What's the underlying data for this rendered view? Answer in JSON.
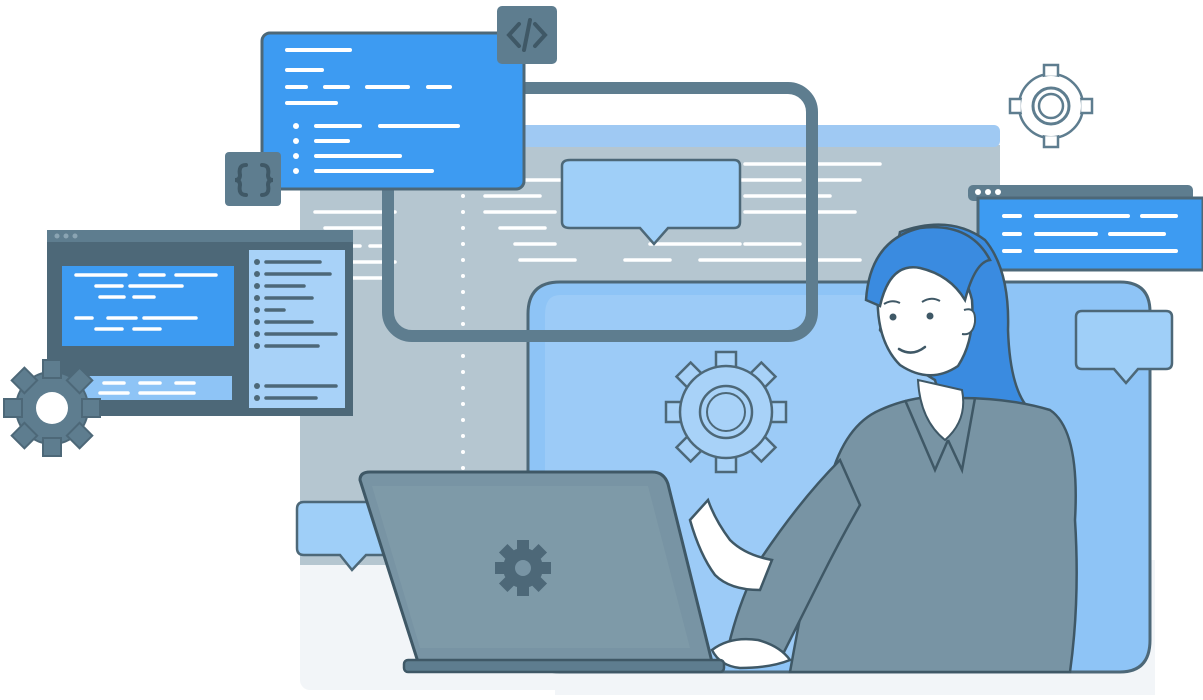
{
  "colors": {
    "background": "#ffffff",
    "panel_light": "#f2f5f8",
    "slate": "#5e7d8f",
    "slate_dark": "#4d6878",
    "slate_mid": "#7894a4",
    "slate_light": "#aebfc9",
    "blue_bright": "#3d9bf2",
    "blue_mid": "#8ec4f6",
    "blue_light": "#a8d2f8",
    "blue_pale": "#c9e3fb",
    "skin": "#ffffff",
    "hair": "#3a8be0",
    "line": "#3f5866"
  },
  "icons": {
    "code_tag": "code-brackets-icon",
    "braces": "curly-braces-icon",
    "gears": "gear-icon",
    "chat": "speech-bubble-icon"
  }
}
